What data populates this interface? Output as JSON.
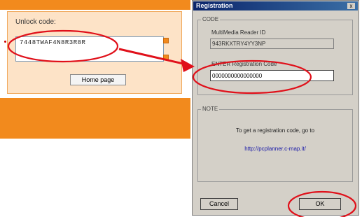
{
  "web_panel": {
    "unlock_label": "Unlock code:",
    "unlock_value": "7448TWAF4N8R3R8R",
    "home_button": "Home page"
  },
  "dialog": {
    "title": "Registration",
    "close": "x",
    "code_group": "CODE",
    "reader_id_label": "MultiMedia Reader ID",
    "reader_id_value": "943RKXTRY4YY3NP",
    "enter_label": "ENTER Registration Code",
    "enter_value": "0000000000000000",
    "note_group": "NOTE",
    "note_text": "To get a registration code, go to",
    "note_link": "http://pcplanner.c-map.it/",
    "cancel_label": "Cancel",
    "ok_label": "OK"
  },
  "colors": {
    "accent_orange": "#f28a1d",
    "annotation_red": "#e0101a",
    "titlebar": "#0a246a"
  }
}
